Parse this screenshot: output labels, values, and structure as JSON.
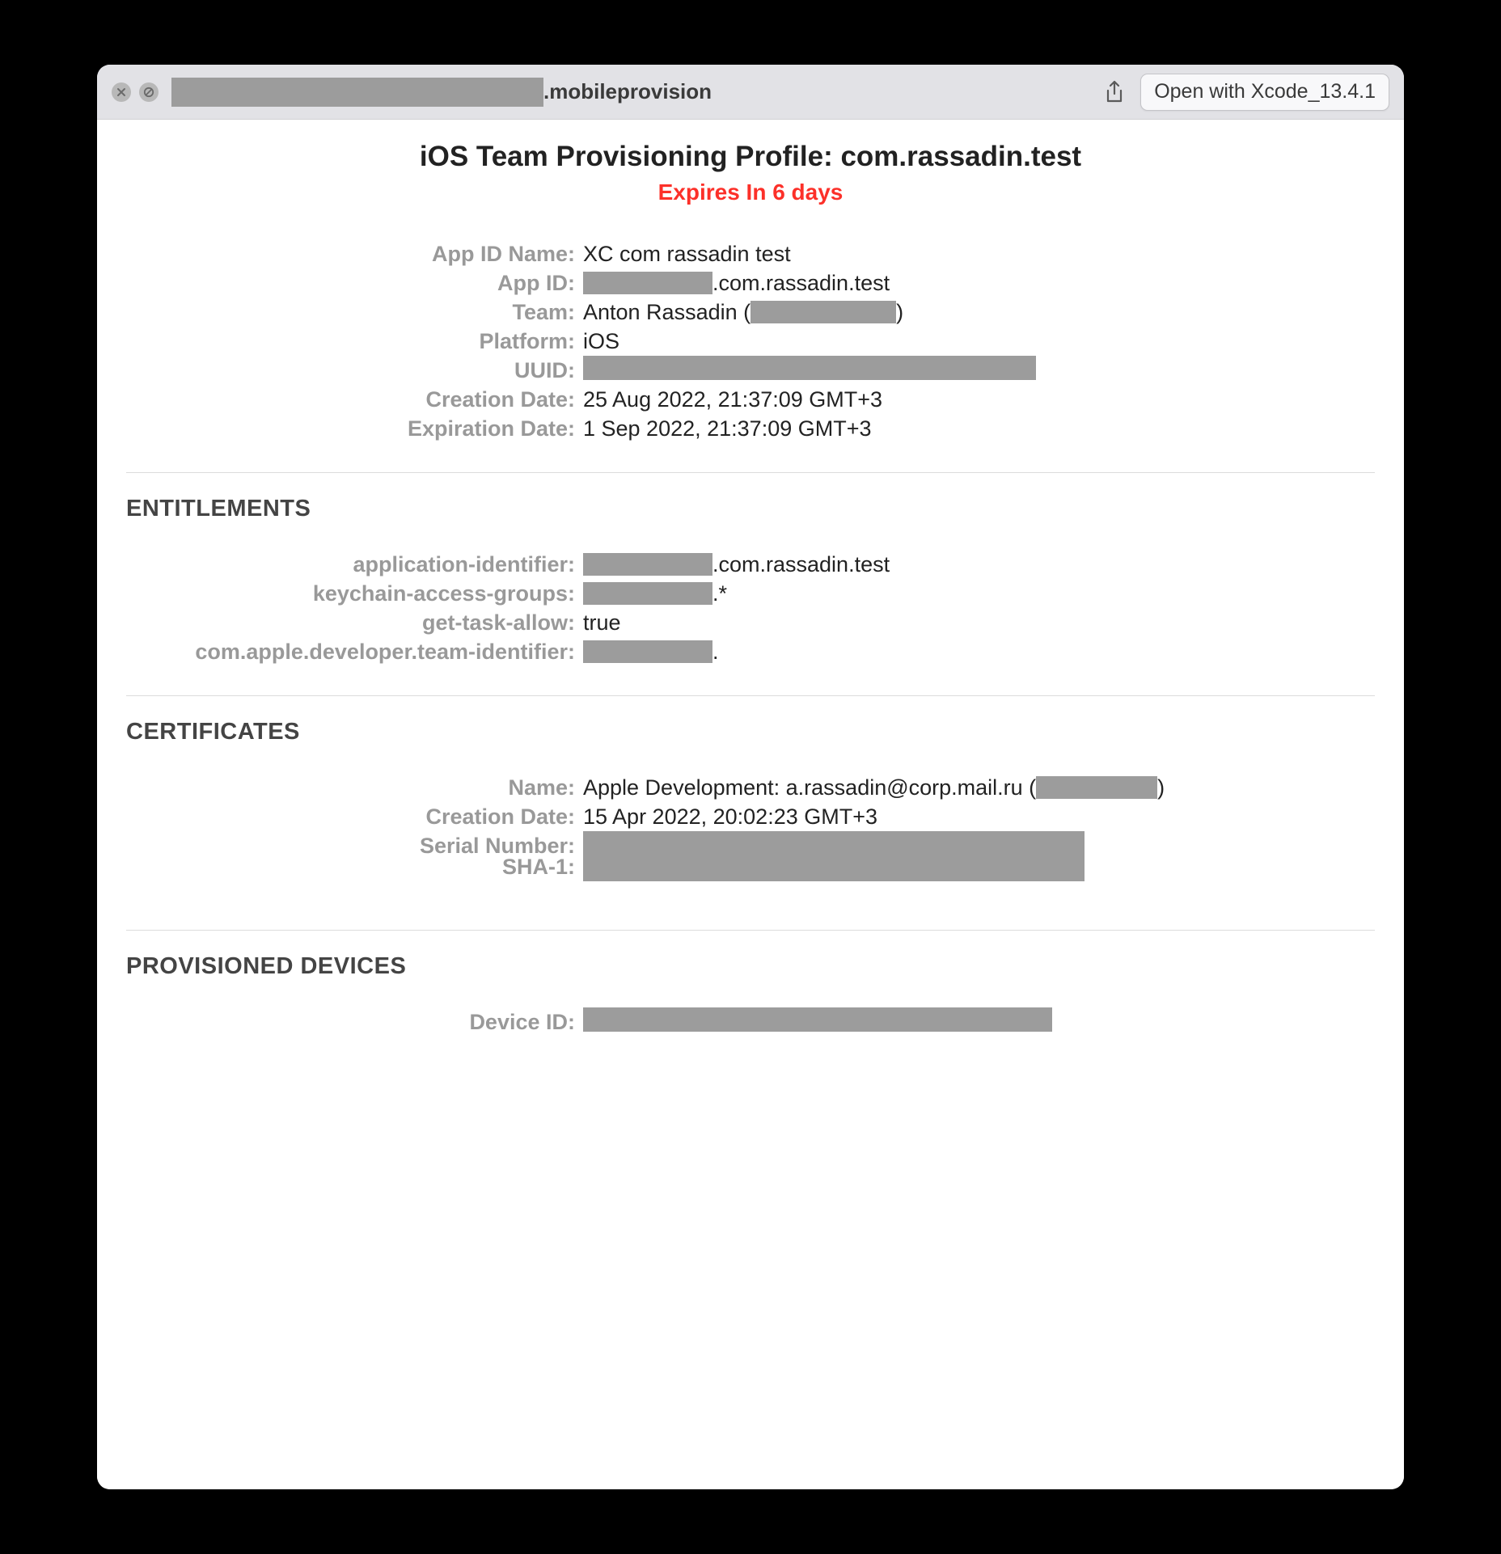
{
  "titlebar": {
    "filename_ext": ".mobileprovision",
    "open_with_label": "Open with Xcode_13.4.1"
  },
  "profile": {
    "title": "iOS Team Provisioning Profile: com.rassadin.test",
    "expires": "Expires In 6 days"
  },
  "general": {
    "app_id_name_label": "App ID Name:",
    "app_id_name_value": "XC com rassadin test",
    "app_id_label": "App ID:",
    "app_id_suffix": ".com.rassadin.test",
    "team_label": "Team:",
    "team_prefix": "Anton Rassadin (",
    "team_suffix": ")",
    "platform_label": "Platform:",
    "platform_value": "iOS",
    "uuid_label": "UUID:",
    "creation_label": "Creation Date:",
    "creation_value": "25 Aug 2022, 21:37:09 GMT+3",
    "expiration_label": "Expiration Date:",
    "expiration_value": "1 Sep 2022, 21:37:09 GMT+3"
  },
  "entitlements": {
    "section_title": "ENTITLEMENTS",
    "app_identifier_label": "application-identifier:",
    "app_identifier_suffix": ".com.rassadin.test",
    "keychain_label": "keychain-access-groups:",
    "keychain_suffix": ".*",
    "get_task_label": "get-task-allow:",
    "get_task_value": "true",
    "team_id_label": "com.apple.developer.team-identifier:",
    "team_id_suffix": "."
  },
  "certificates": {
    "section_title": "CERTIFICATES",
    "name_label": "Name:",
    "name_prefix": "Apple Development: a.rassadin@corp.mail.ru (",
    "name_suffix": ")",
    "creation_label": "Creation Date:",
    "creation_value": "15 Apr 2022, 20:02:23 GMT+3",
    "serial_label": "Serial Number:",
    "sha1_label": "SHA-1:"
  },
  "devices": {
    "section_title": "PROVISIONED DEVICES",
    "device_id_label": "Device ID:"
  }
}
